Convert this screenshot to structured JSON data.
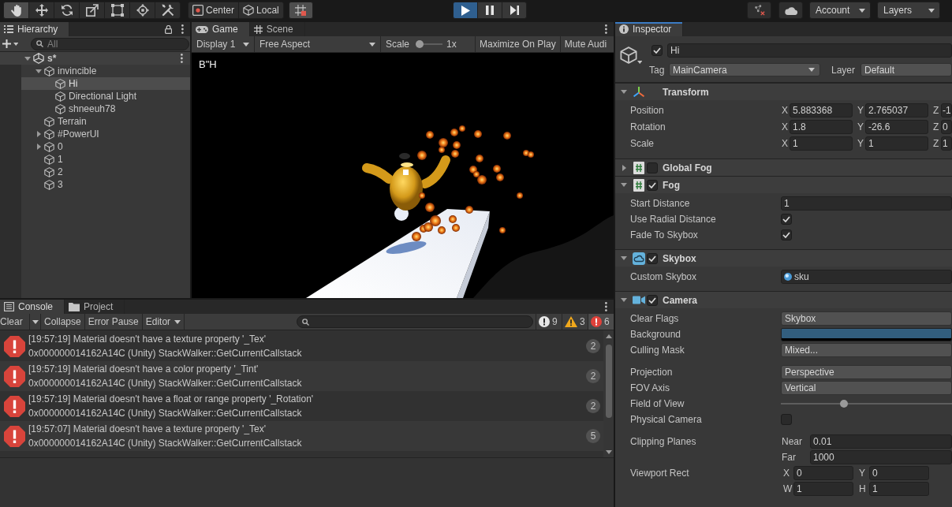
{
  "toolbar": {
    "tools": [
      {
        "kind": "hand",
        "selected": true
      },
      {
        "kind": "move",
        "selected": false
      },
      {
        "kind": "rotate",
        "selected": false
      },
      {
        "kind": "scale",
        "selected": false
      },
      {
        "kind": "rect",
        "selected": false
      },
      {
        "kind": "transform",
        "selected": false
      },
      {
        "kind": "custom",
        "selected": false
      }
    ],
    "pivot_mode": "Center",
    "pivot_rotation": "Local",
    "grid_snap": {
      "on": true
    },
    "play_controls": [
      {
        "kind": "play",
        "on": true
      },
      {
        "kind": "pause",
        "on": false
      },
      {
        "kind": "step",
        "on": false
      }
    ],
    "account": "Account",
    "layers": "Layers"
  },
  "hierarchy": {
    "tabs": [
      {
        "label": "Hierarchy",
        "kind": "hierarchy",
        "selected": true
      }
    ],
    "search": {
      "placeholder": "All"
    },
    "tree": [
      {
        "name": "s*",
        "kind": "scene",
        "expanded": true,
        "selected": false,
        "children": [
          {
            "name": "invincible",
            "kind": "object",
            "expanded": true,
            "selected": false,
            "children": [
              {
                "name": "Hi",
                "kind": "object",
                "selected": true
              },
              {
                "name": "Directional Light",
                "kind": "object",
                "selected": false
              },
              {
                "name": "shneeuh78",
                "kind": "object",
                "selected": false
              }
            ]
          },
          {
            "name": "Terrain",
            "kind": "object",
            "selected": false
          },
          {
            "name": "#PowerUI",
            "kind": "object",
            "expanded": false,
            "selected": false
          },
          {
            "name": "0",
            "kind": "object",
            "expanded": false,
            "selected": false
          },
          {
            "name": "1",
            "kind": "object",
            "selected": false
          },
          {
            "name": "2",
            "kind": "object",
            "selected": false
          },
          {
            "name": "3",
            "kind": "object",
            "selected": false
          }
        ]
      }
    ]
  },
  "game": {
    "tabs": [
      {
        "label": "Game",
        "kind": "game",
        "selected": true
      },
      {
        "label": "Scene",
        "kind": "scene",
        "selected": false
      }
    ],
    "toolbar": {
      "display": "Display 1",
      "aspect": "Free Aspect",
      "scale": {
        "label": "Scale",
        "level": 0,
        "reading": "1x"
      },
      "buttons": [
        "Maximize On Play",
        "Mute Audi"
      ]
    },
    "viewport": {
      "overlay_text": "B\"H"
    }
  },
  "console": {
    "tabs": [
      {
        "label": "Console",
        "kind": "console",
        "selected": true
      },
      {
        "label": "Project",
        "kind": "project",
        "selected": false
      }
    ],
    "toolbar": {
      "clear": "Clear",
      "collapse": "Collapse",
      "error_pause": "Error Pause",
      "editor": "Editor"
    },
    "counters": [
      {
        "kind": "info",
        "count": "9",
        "on": false
      },
      {
        "kind": "warning",
        "count": "3",
        "on": false
      },
      {
        "kind": "error",
        "count": "6",
        "on": true
      }
    ],
    "entries": [
      {
        "kind": "error",
        "message": "[19:57:19] Material doesn't have a texture property '_Tex'",
        "detail": "0x000000014162A14C (Unity) StackWalker::GetCurrentCallstack",
        "count": "2"
      },
      {
        "kind": "error",
        "message": "[19:57:19] Material doesn't have a color property '_Tint'",
        "detail": "0x000000014162A14C (Unity) StackWalker::GetCurrentCallstack",
        "count": "2"
      },
      {
        "kind": "error",
        "message": "[19:57:19] Material doesn't have a float or range property '_Rotation'",
        "detail": "0x000000014162A14C (Unity) StackWalker::GetCurrentCallstack",
        "count": "2"
      },
      {
        "kind": "error",
        "message": "[19:57:07] Material doesn't have a texture property '_Tex'",
        "detail": "0x000000014162A14C (Unity) StackWalker::GetCurrentCallstack",
        "count": "5"
      }
    ]
  },
  "inspector": {
    "focused": true,
    "tabs": [
      {
        "label": "Inspector",
        "kind": "inspector",
        "selected": true
      }
    ],
    "object": {
      "active": true,
      "name": "Hi",
      "tag_label": "Tag",
      "tag": "MainCamera",
      "layer_label": "Layer",
      "layer": "Default"
    },
    "components": [
      {
        "kind": "transform",
        "title": "Transform",
        "expanded": true,
        "sections": [
          [
            {
              "label": "Position",
              "kind": "vector",
              "fields": [
                {
                  "axis": "X",
                  "value": "5.883368"
                },
                {
                  "axis": "Y",
                  "value": "2.765037"
                },
                {
                  "axis": "Z",
                  "value": "-1"
                }
              ]
            },
            {
              "label": "Rotation",
              "kind": "vector",
              "fields": [
                {
                  "axis": "X",
                  "value": "1.8"
                },
                {
                  "axis": "Y",
                  "value": "-26.6"
                },
                {
                  "axis": "Z",
                  "value": "0"
                }
              ]
            },
            {
              "label": "Scale",
              "kind": "vector",
              "fields": [
                {
                  "axis": "X",
                  "value": "1"
                },
                {
                  "axis": "Y",
                  "value": "1"
                },
                {
                  "axis": "Z",
                  "value": "1"
                }
              ]
            }
          ]
        ]
      },
      {
        "kind": "script",
        "title": "Global Fog",
        "expanded": false,
        "enabled": false
      },
      {
        "kind": "script",
        "title": "Fog",
        "expanded": true,
        "enabled": true,
        "sections": [
          [
            {
              "label": "Start Distance",
              "kind": "number",
              "value": "1"
            },
            {
              "label": "Use Radial Distance",
              "kind": "toggle",
              "checked": true
            },
            {
              "label": "Fade To Skybox",
              "kind": "toggle",
              "checked": true
            }
          ]
        ]
      },
      {
        "kind": "skybox",
        "title": "Skybox",
        "expanded": true,
        "enabled": true,
        "sections": [
          [
            {
              "label": "Custom Skybox",
              "kind": "object",
              "value": "sku"
            }
          ]
        ]
      },
      {
        "kind": "camera",
        "title": "Camera",
        "expanded": true,
        "enabled": true,
        "sections": [
          [
            {
              "label": "Clear Flags",
              "kind": "dropdown",
              "value": "Skybox"
            },
            {
              "label": "Background",
              "kind": "color",
              "color": "#325e7e"
            },
            {
              "label": "Culling Mask",
              "kind": "dropdown",
              "value": "Mixed..."
            }
          ],
          [
            {
              "label": "Projection",
              "kind": "dropdown",
              "value": "Perspective"
            },
            {
              "label": "FOV Axis",
              "kind": "dropdown",
              "value": "Vertical"
            },
            {
              "label": "Field of View",
              "kind": "slider",
              "level": 0.36
            },
            {
              "label": "Physical Camera",
              "kind": "toggle",
              "checked": false
            }
          ],
          [
            {
              "label": "Clipping Planes",
              "kind": "labeled_fields",
              "fields": [
                {
                  "label": "Near",
                  "value": "0.01"
                },
                {
                  "label": "Far",
                  "value": "1000"
                }
              ]
            },
            {
              "label": "Viewport Rect",
              "kind": "rect",
              "fields": [
                {
                  "axis": "X",
                  "value": "0"
                },
                {
                  "axis": "Y",
                  "value": "0"
                },
                {
                  "axis": "W",
                  "value": "1"
                },
                {
                  "axis": "H",
                  "value": "1"
                }
              ]
            }
          ]
        ]
      }
    ]
  }
}
